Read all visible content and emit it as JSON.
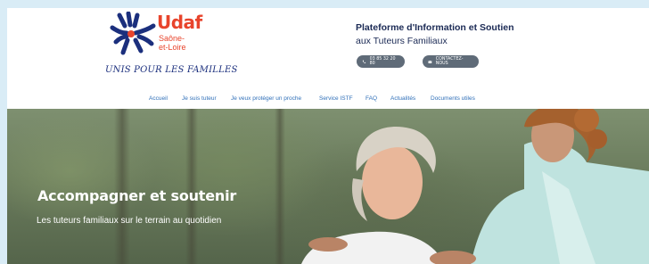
{
  "brand": {
    "name": "Udaf",
    "region_line1": "Saône-",
    "region_line2": "et-Loire",
    "slogan": "UNIS POUR LES FAMILLES",
    "colors": {
      "primary": "#e8442c",
      "navy": "#1b2f7d"
    }
  },
  "header": {
    "platform_title": "Plateforme d'Information et Soutien",
    "platform_subtitle": "aux Tuteurs Familiaux",
    "phone_button": {
      "label": "03 85 32 20 80",
      "icon": "phone-icon"
    },
    "contact_button": {
      "label": "CONTACTEZ-NOUS",
      "icon": "envelope-icon"
    }
  },
  "nav": {
    "items": [
      {
        "label": "Accueil"
      },
      {
        "label": "Je suis tuteur"
      },
      {
        "label": "Je veux protéger un proche"
      },
      {
        "label": "Service ISTF"
      },
      {
        "label": "FAQ"
      },
      {
        "label": "Actualités"
      },
      {
        "label": "Documents utiles"
      }
    ]
  },
  "hero": {
    "title": "Accompagner et soutenir",
    "subtitle": "Les tuteurs familiaux sur le terrain au quotidien"
  }
}
